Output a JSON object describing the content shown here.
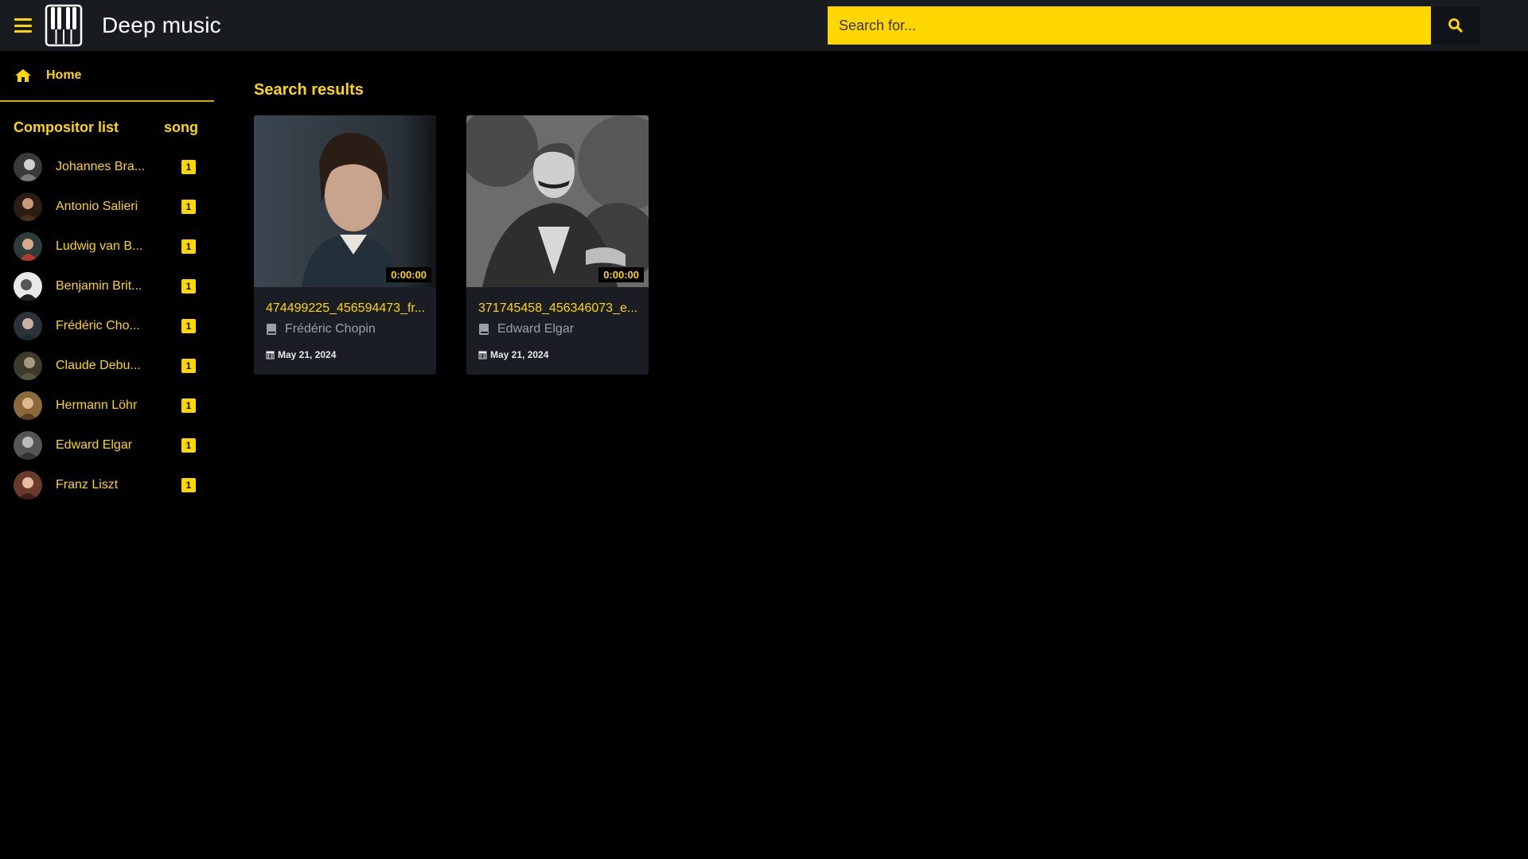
{
  "header": {
    "app_title": "Deep music",
    "search_placeholder": "Search for...",
    "colors": {
      "bar": "#181c21",
      "accent": "#ffd700"
    }
  },
  "sidebar": {
    "home_label": "Home",
    "list_title": "Compositor list",
    "count_column": "song",
    "composers": [
      {
        "name": "Johannes Bra...",
        "count": "1"
      },
      {
        "name": "Antonio Salieri",
        "count": "1"
      },
      {
        "name": "Ludwig van B...",
        "count": "1"
      },
      {
        "name": "Benjamin Brit...",
        "count": "1"
      },
      {
        "name": "Frédéric Cho...",
        "count": "1"
      },
      {
        "name": "Claude Debu...",
        "count": "1"
      },
      {
        "name": "Hermann Löhr",
        "count": "1"
      },
      {
        "name": "Edward Elgar",
        "count": "1"
      },
      {
        "name": "Franz Liszt",
        "count": "1"
      }
    ]
  },
  "main": {
    "results_title": "Search results",
    "cards": [
      {
        "title": "474499225_456594473_fr...",
        "author": "Frédéric Chopin",
        "date": "May 21, 2024",
        "duration": "0:00:00"
      },
      {
        "title": "371745458_456346073_e...",
        "author": "Edward Elgar",
        "date": "May 21, 2024",
        "duration": "0:00:00"
      }
    ]
  }
}
